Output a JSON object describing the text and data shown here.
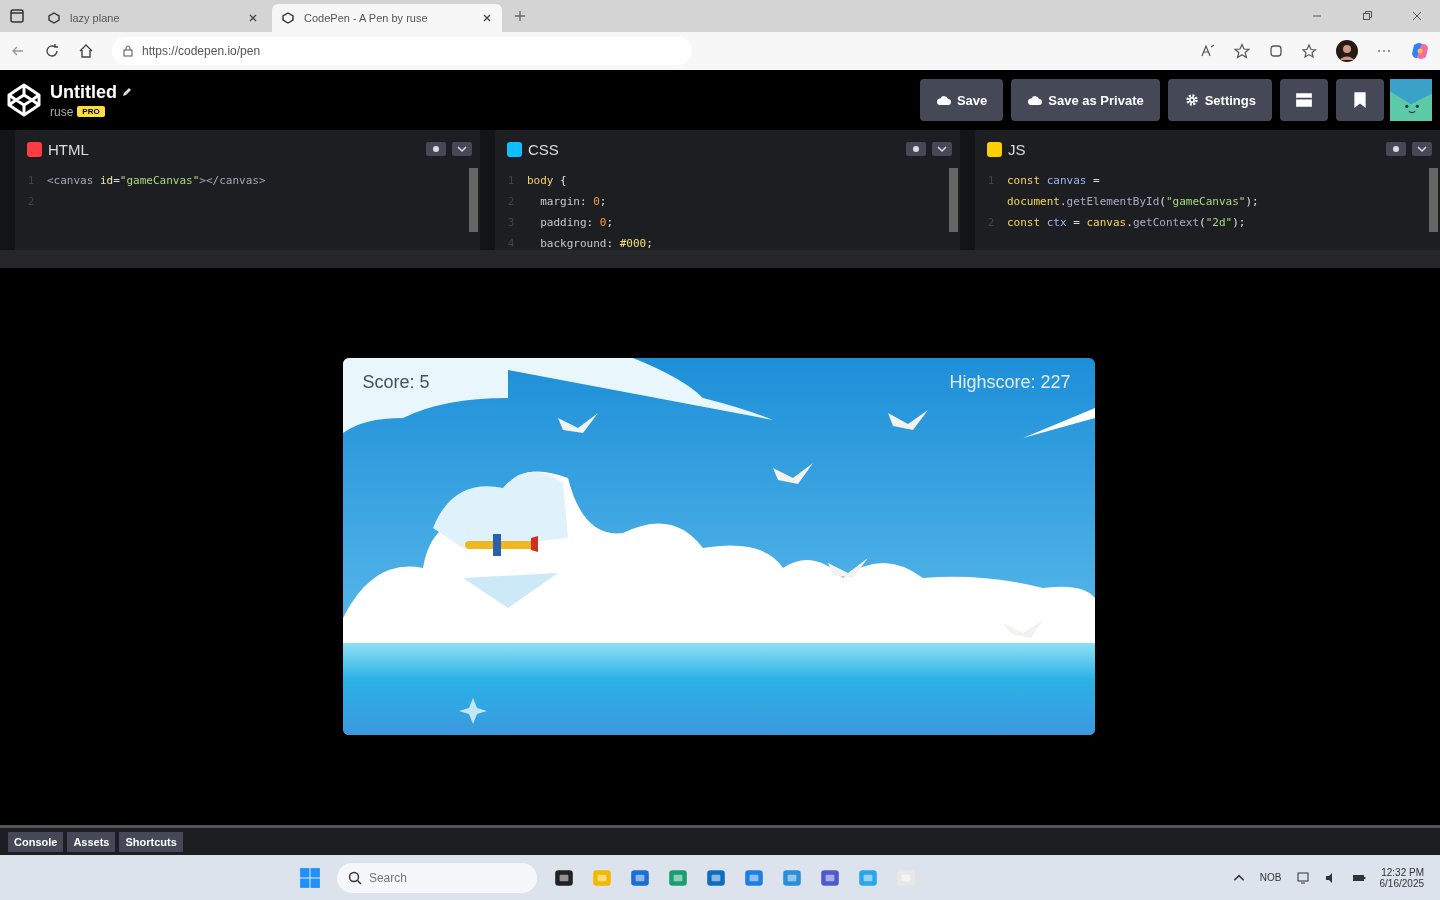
{
  "browser": {
    "tabs": [
      {
        "title": "lazy plane",
        "selected": false
      },
      {
        "title": "CodePen - A Pen by ruse",
        "selected": true
      }
    ],
    "url": "https://codepen.io/pen"
  },
  "header": {
    "title": "Untitled",
    "user": "ruse",
    "badge": "PRO",
    "buttons": [
      {
        "label": "Save",
        "kind": "cloud"
      },
      {
        "label": "Save as Private",
        "kind": "cloud"
      },
      {
        "label": "Settings",
        "kind": "gear"
      }
    ]
  },
  "editors": [
    {
      "name": "HTML",
      "color": "#ff3c41",
      "lines": [
        {
          "num": "1",
          "tokens": [
            {
              "text": "<canvas ",
              "kind": "tag"
            },
            {
              "text": "id",
              "kind": "attr"
            },
            {
              "text": "=",
              "kind": "punct"
            },
            {
              "text": "\"gameCanvas\"",
              "kind": "str"
            },
            {
              "text": "></canvas>",
              "kind": "tag"
            }
          ]
        },
        {
          "num": "2"
        }
      ]
    },
    {
      "name": "CSS",
      "color": "#0ebeff",
      "lines": [
        {
          "num": "1",
          "tokens": [
            {
              "text": "body",
              "kind": "kw"
            },
            {
              "text": " {",
              "kind": "punct"
            }
          ]
        },
        {
          "num": "2",
          "tokens": [
            {
              "text": "  margin",
              "kind": "prop"
            },
            {
              "text": ": ",
              "kind": "punct"
            },
            {
              "text": "0",
              "kind": "num"
            },
            {
              "text": ";",
              "kind": "punct"
            }
          ]
        },
        {
          "num": "3",
          "tokens": [
            {
              "text": "  padding",
              "kind": "prop"
            },
            {
              "text": ": ",
              "kind": "punct"
            },
            {
              "text": "0",
              "kind": "num"
            },
            {
              "text": ";",
              "kind": "punct"
            }
          ]
        },
        {
          "num": "4",
          "tokens": [
            {
              "text": "  background",
              "kind": "prop"
            },
            {
              "text": ": ",
              "kind": "punct"
            },
            {
              "text": "#000",
              "kind": "hex"
            },
            {
              "text": ";",
              "kind": "punct"
            }
          ]
        }
      ]
    },
    {
      "name": "JS",
      "color": "#fcd000",
      "lines": [
        {
          "num": "1",
          "tokens": [
            {
              "text": "const ",
              "kind": "kw"
            },
            {
              "text": "canvas",
              "kind": "var"
            },
            {
              "text": " =",
              "kind": "punct"
            }
          ]
        },
        {
          "tokens": [
            {
              "text": "document",
              "kind": "kw"
            },
            {
              "text": ".",
              "kind": "punct"
            },
            {
              "text": "getElementById",
              "kind": "fn"
            },
            {
              "text": "(",
              "kind": "punct"
            },
            {
              "text": "\"gameCanvas\"",
              "kind": "str"
            },
            {
              "text": ");",
              "kind": "punct"
            }
          ]
        },
        {
          "num": "2",
          "tokens": [
            {
              "text": "const ",
              "kind": "kw"
            },
            {
              "text": "ctx",
              "kind": "var"
            },
            {
              "text": " = ",
              "kind": "punct"
            },
            {
              "text": "canvas",
              "kind": "kw"
            },
            {
              "text": ".",
              "kind": "punct"
            },
            {
              "text": "getContext",
              "kind": "fn"
            },
            {
              "text": "(",
              "kind": "punct"
            },
            {
              "text": "\"2d\"",
              "kind": "str"
            },
            {
              "text": ");",
              "kind": "punct"
            }
          ]
        }
      ]
    }
  ],
  "game": {
    "score": "Score: 5",
    "highscore": "Highscore: 227"
  },
  "footer_tabs": [
    "Console",
    "Assets",
    "Shortcuts"
  ],
  "taskbar": {
    "search_placeholder": "Search",
    "language": "NOB",
    "time": "12:32 PM",
    "date": "6/16/2025"
  }
}
